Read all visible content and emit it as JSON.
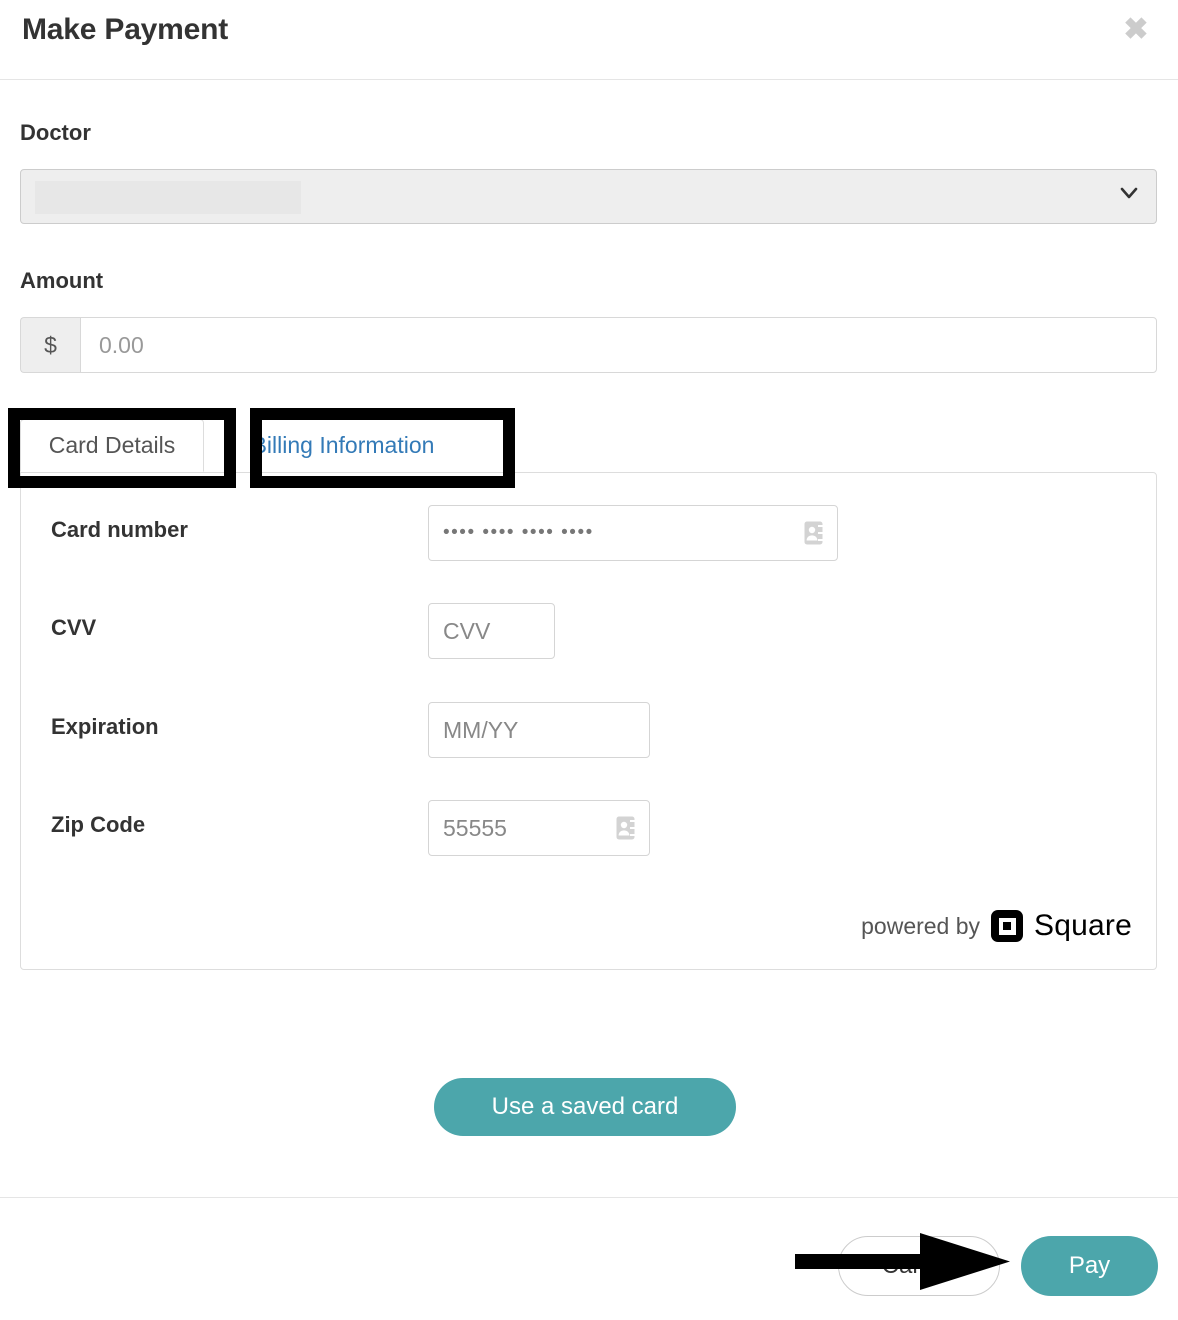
{
  "modal": {
    "title": "Make Payment",
    "close_icon": "close-icon"
  },
  "form": {
    "doctor_label": "Doctor",
    "doctor_value": "",
    "doctor_chevron_icon": "chevron-down-icon",
    "amount_label": "Amount",
    "amount_prefix": "$",
    "amount_placeholder": "0.00",
    "amount_value": ""
  },
  "tabs": [
    {
      "label": "Card Details",
      "active": true
    },
    {
      "label": "Billing Information",
      "active": false
    }
  ],
  "card_details": {
    "rows": [
      {
        "label": "Card number",
        "placeholder": "•••• •••• •••• ••••",
        "icon": "contact-card-autofill-icon"
      },
      {
        "label": "CVV",
        "placeholder": "CVV",
        "icon": ""
      },
      {
        "label": "Expiration",
        "placeholder": "MM/YY",
        "icon": ""
      },
      {
        "label": "Zip Code",
        "placeholder": "55555",
        "icon": "contact-card-autofill-icon"
      }
    ],
    "brand_prefix": "powered by",
    "brand_name": "Square"
  },
  "actions": {
    "saved_card_label": "Use a saved card",
    "cancel_label": "Cancel",
    "pay_label": "Pay"
  },
  "colors": {
    "accent_teal": "#4ca6ab",
    "link_blue": "#337ab7",
    "annotation_black": "#000000",
    "border_gray": "#dddddd"
  }
}
